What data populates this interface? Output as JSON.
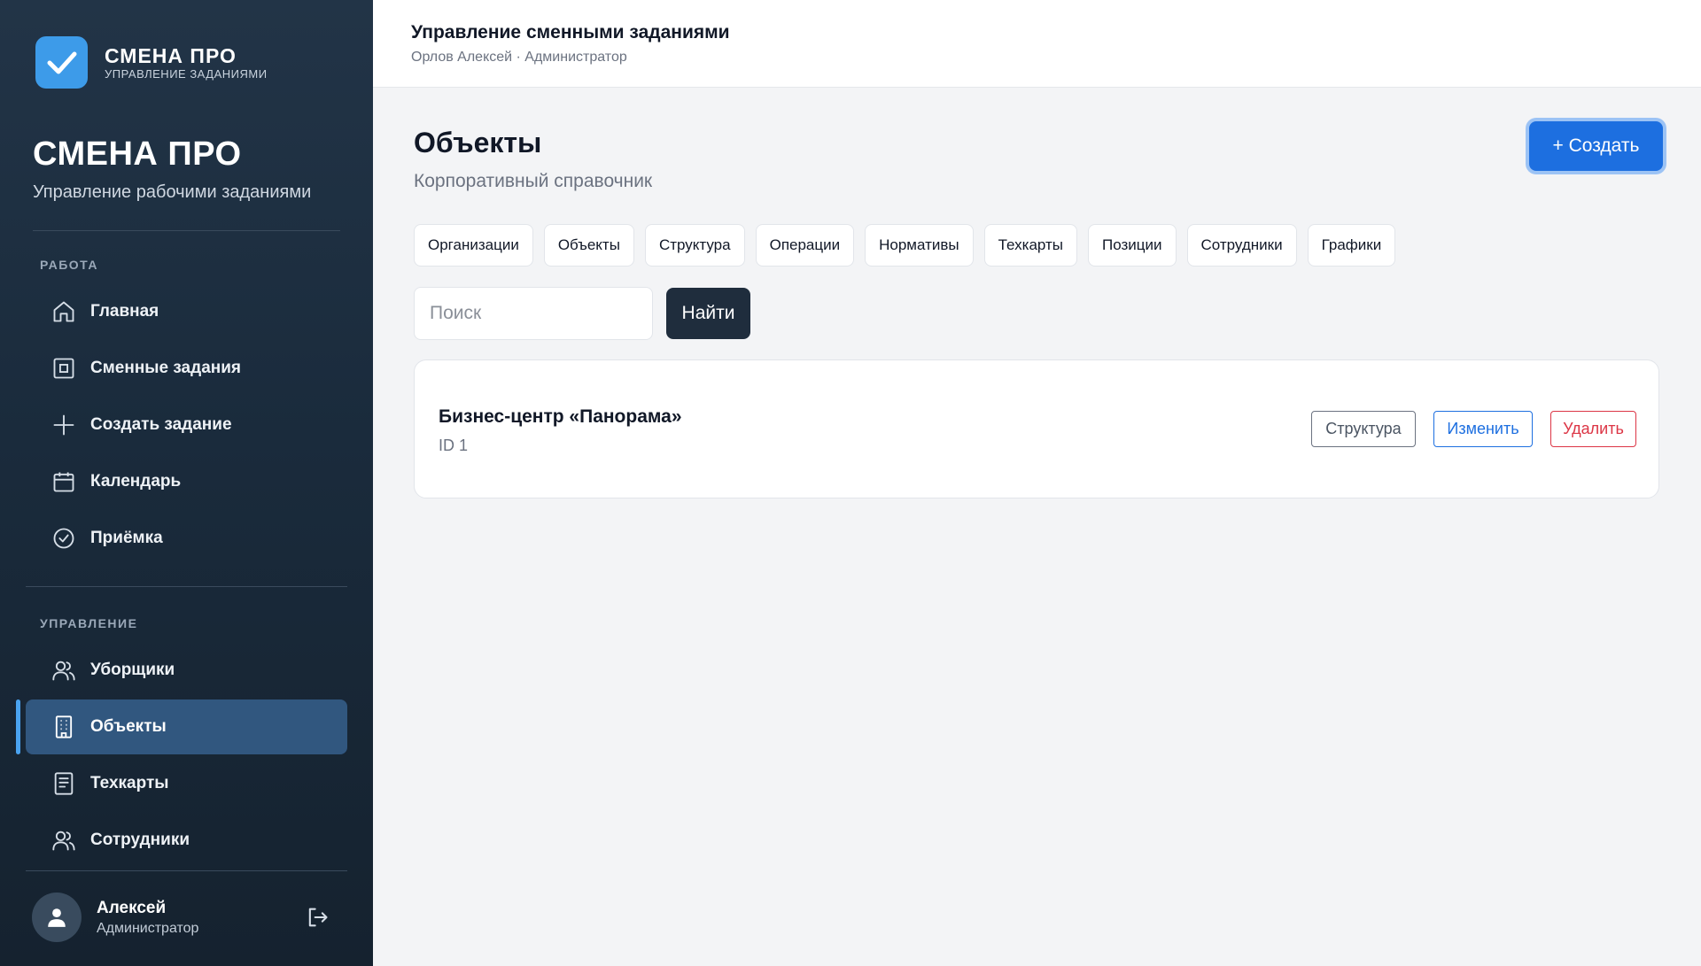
{
  "app": {
    "logo_title": "СМЕНА ПРО",
    "logo_subtitle": "УПРАВЛЕНИЕ ЗАДАНИЯМИ",
    "brand_title": "СМЕНА ПРО",
    "brand_subtitle": "Управление рабочими заданиями"
  },
  "sidebar": {
    "section_work": "РАБОТА",
    "work_items": [
      {
        "label": "Главная",
        "icon": "home-icon"
      },
      {
        "label": "Сменные задания",
        "icon": "square-icon"
      },
      {
        "label": "Создать задание",
        "icon": "plus-icon"
      },
      {
        "label": "Календарь",
        "icon": "calendar-icon"
      },
      {
        "label": "Приёмка",
        "icon": "check-circle-icon"
      }
    ],
    "section_manage": "УПРАВЛЕНИЕ",
    "manage_items": [
      {
        "label": "Уборщики",
        "icon": "users-icon"
      },
      {
        "label": "Объекты",
        "icon": "building-icon",
        "active": true
      },
      {
        "label": "Техкарты",
        "icon": "document-icon"
      },
      {
        "label": "Сотрудники",
        "icon": "users-icon"
      }
    ],
    "user": {
      "name": "Алексей",
      "role": "Администратор"
    }
  },
  "header": {
    "title": "Управление сменными заданиями",
    "subtitle": "Орлов Алексей · Администратор"
  },
  "main": {
    "title": "Объекты",
    "subtitle": "Корпоративный справочник",
    "create_label": "+ Создать",
    "tabs": [
      "Организации",
      "Объекты",
      "Структура",
      "Операции",
      "Нормативы",
      "Техкарты",
      "Позиции",
      "Сотрудники",
      "Графики"
    ],
    "search": {
      "placeholder": "Поиск",
      "value": "",
      "button_label": "Найти"
    },
    "items": [
      {
        "name": "Бизнес-центр «Панорама»",
        "id_text": "ID 1",
        "structure_label": "Структура",
        "edit_label": "Изменить",
        "delete_label": "Удалить"
      }
    ]
  },
  "colors": {
    "accent": "#1d6fe0",
    "sidebar_active": "#31577f",
    "danger": "#dc3545",
    "logo": "#3d9be9"
  }
}
